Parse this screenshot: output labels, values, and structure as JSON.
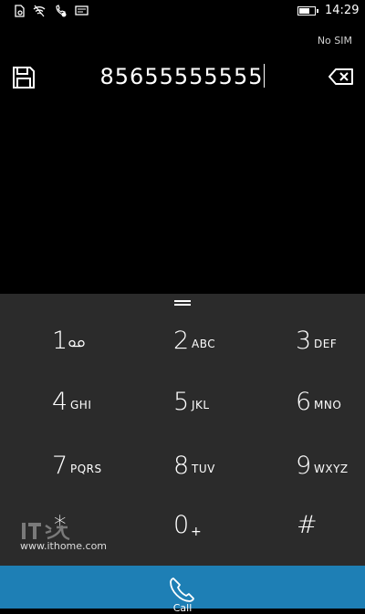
{
  "status": {
    "time": "14:29",
    "carrier": "No SIM",
    "battery_level": 0.7,
    "icons": [
      "sim-icon",
      "wifi-icon",
      "call-forward-icon",
      "message-icon"
    ]
  },
  "dialer": {
    "number": "85655555555",
    "save_icon": "save-icon",
    "backspace_icon": "backspace-icon"
  },
  "keypad": {
    "keys": [
      {
        "digit": "1",
        "letters": "",
        "extra_icon": "voicemail-icon"
      },
      {
        "digit": "2",
        "letters": "ABC"
      },
      {
        "digit": "3",
        "letters": "DEF"
      },
      {
        "digit": "4",
        "letters": "GHI"
      },
      {
        "digit": "5",
        "letters": "JKL"
      },
      {
        "digit": "6",
        "letters": "MNO"
      },
      {
        "digit": "7",
        "letters": "PQRS"
      },
      {
        "digit": "8",
        "letters": "TUV"
      },
      {
        "digit": "9",
        "letters": "WXYZ"
      },
      {
        "digit": "*",
        "letters": ""
      },
      {
        "digit": "0",
        "letters": "+"
      },
      {
        "digit": "#",
        "letters": ""
      }
    ]
  },
  "watermark": {
    "text": "www.ithome.com",
    "logo_text": "IT之家"
  },
  "callbar": {
    "label": "Call",
    "icon": "phone-icon",
    "color": "#1e7fb5"
  }
}
